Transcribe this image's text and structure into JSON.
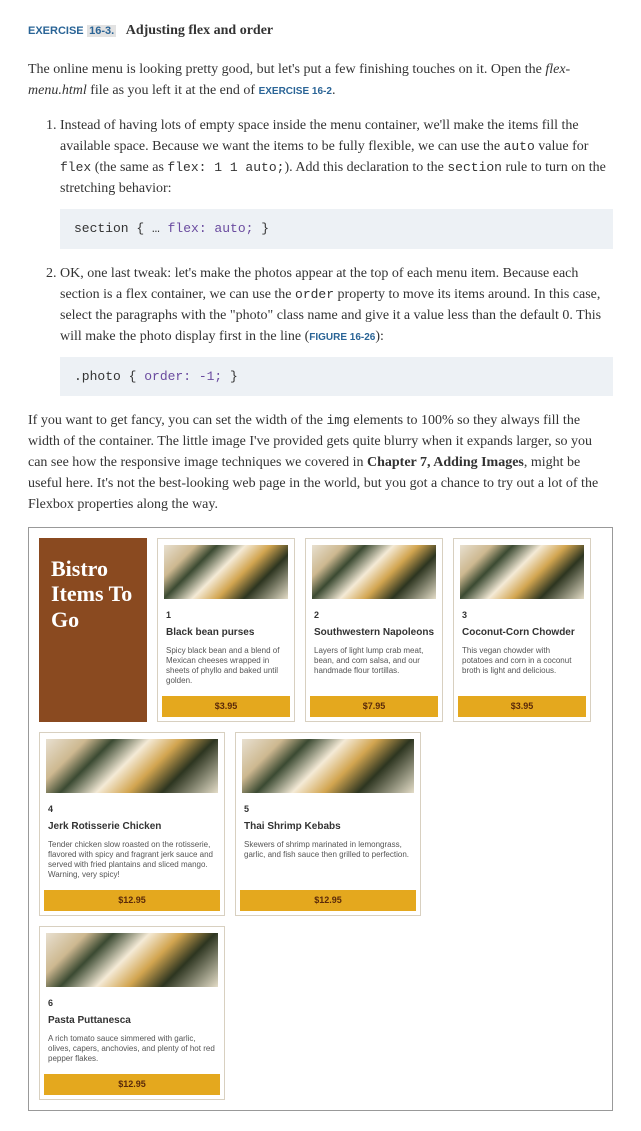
{
  "exercise": {
    "label": "EXERCISE",
    "number": "16-3.",
    "title": "Adjusting flex and order"
  },
  "intro": {
    "t1": "The online menu is looking pretty good, but let's put a few finishing touches on it. Open the ",
    "file": "flex-menu.html",
    "t2": " file as you left it at the end of ",
    "link": "EXERCISE 16-2",
    "t3": "."
  },
  "steps": [
    {
      "p1": "Instead of having lots of empty space inside the menu container, we'll make the items fill the available space. Because we want the items to be fully flexible, we can use the ",
      "c1": "auto",
      "p2": " value for ",
      "c2": "flex",
      "p3": " (the same as ",
      "c3": "flex: 1 1 auto;",
      "p4": "). Add this declaration to the ",
      "c4": "section",
      "p5": " rule to turn on the stretching behavior:",
      "code_pre": "section {  …  ",
      "code_hi": "flex: auto;",
      "code_post": " }"
    },
    {
      "p1": "OK, one last tweak: let's make the photos appear at the top of each menu item. Because each section is a flex container, we can use the ",
      "c1": "order",
      "p2": " property to move its items around. In this case, select the paragraphs with the \"photo\" class name and give it a value less than the default 0. This will make the photo display first in the line (",
      "link": "FIGURE 16-26",
      "p3": "):",
      "code_pre": ".photo {  ",
      "code_hi": "order: -1;",
      "code_post": " }"
    }
  ],
  "closing": {
    "t1": "If you want to get fancy, you can set the width of the ",
    "c1": "img",
    "t2": " elements to 100% so they always fill the width of the container. The little image I've provided gets quite blurry when it expands larger, so you can see how the responsive image techniques we covered in ",
    "b1": "Chapter 7, Adding Images",
    "t3": ", might be useful here. It's not the best-looking web page in the world, but you got a chance to try out a lot of the Flexbox properties along the way."
  },
  "figure": {
    "header": "Bistro Items To Go",
    "cards": [
      {
        "num": "1",
        "title": "Black bean purses",
        "desc": "Spicy black bean and a blend of Mexican cheeses wrapped in sheets of phyllo and baked until golden.",
        "price": "$3.95"
      },
      {
        "num": "2",
        "title": "Southwestern Napoleons",
        "desc": "Layers of light lump crab meat, bean, and corn salsa, and our handmade flour tortillas.",
        "price": "$7.95"
      },
      {
        "num": "3",
        "title": "Coconut-Corn Chowder",
        "desc": "This vegan chowder with potatoes and corn in a coconut broth is light and delicious.",
        "price": "$3.95"
      },
      {
        "num": "4",
        "title": "Jerk Rotisserie Chicken",
        "desc": "Tender chicken slow roasted on the rotisserie, flavored with spicy and fragrant jerk sauce and served with fried plantains and sliced mango. Warning, very spicy!",
        "price": "$12.95"
      },
      {
        "num": "5",
        "title": "Thai Shrimp Kebabs",
        "desc": "Skewers of shrimp marinated in lemongrass, garlic, and fish sauce then grilled to perfection.",
        "price": "$12.95"
      },
      {
        "num": "6",
        "title": "Pasta Puttanesca",
        "desc": "A rich tomato sauce simmered with garlic, olives, capers, anchovies, and plenty of hot red pepper flakes.",
        "price": "$12.95"
      }
    ]
  }
}
